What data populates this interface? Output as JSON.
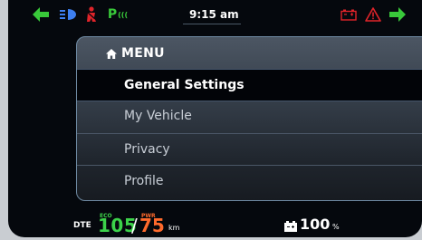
{
  "status_bar": {
    "time": "9:15 am",
    "park_label": "P",
    "park_suffix": "(((",
    "icons": [
      "turn-left-arrow-icon",
      "low-beam-icon",
      "seatbelt-icon",
      "parking-brake-icon",
      "battery-warning-icon",
      "warning-triangle-icon",
      "turn-right-arrow-icon"
    ],
    "colors": {
      "green": "#39c93a",
      "red": "#e0242a",
      "blue": "#3d7ff0"
    }
  },
  "menu": {
    "title": "MENU",
    "items": [
      {
        "label": "General Settings",
        "selected": true
      },
      {
        "label": "My Vehicle",
        "selected": false
      },
      {
        "label": "Privacy",
        "selected": false
      },
      {
        "label": "Profile",
        "selected": false
      }
    ]
  },
  "bottom_bar": {
    "dte_label": "DTE",
    "eco_label": "ECO",
    "eco_value": "105",
    "separator": "/",
    "pwr_label": "PWR",
    "pwr_value": "75",
    "distance_unit": "km",
    "battery_value": "100",
    "battery_unit": "%",
    "colors": {
      "eco": "#3cd24a",
      "pwr": "#ff6a2c"
    }
  }
}
